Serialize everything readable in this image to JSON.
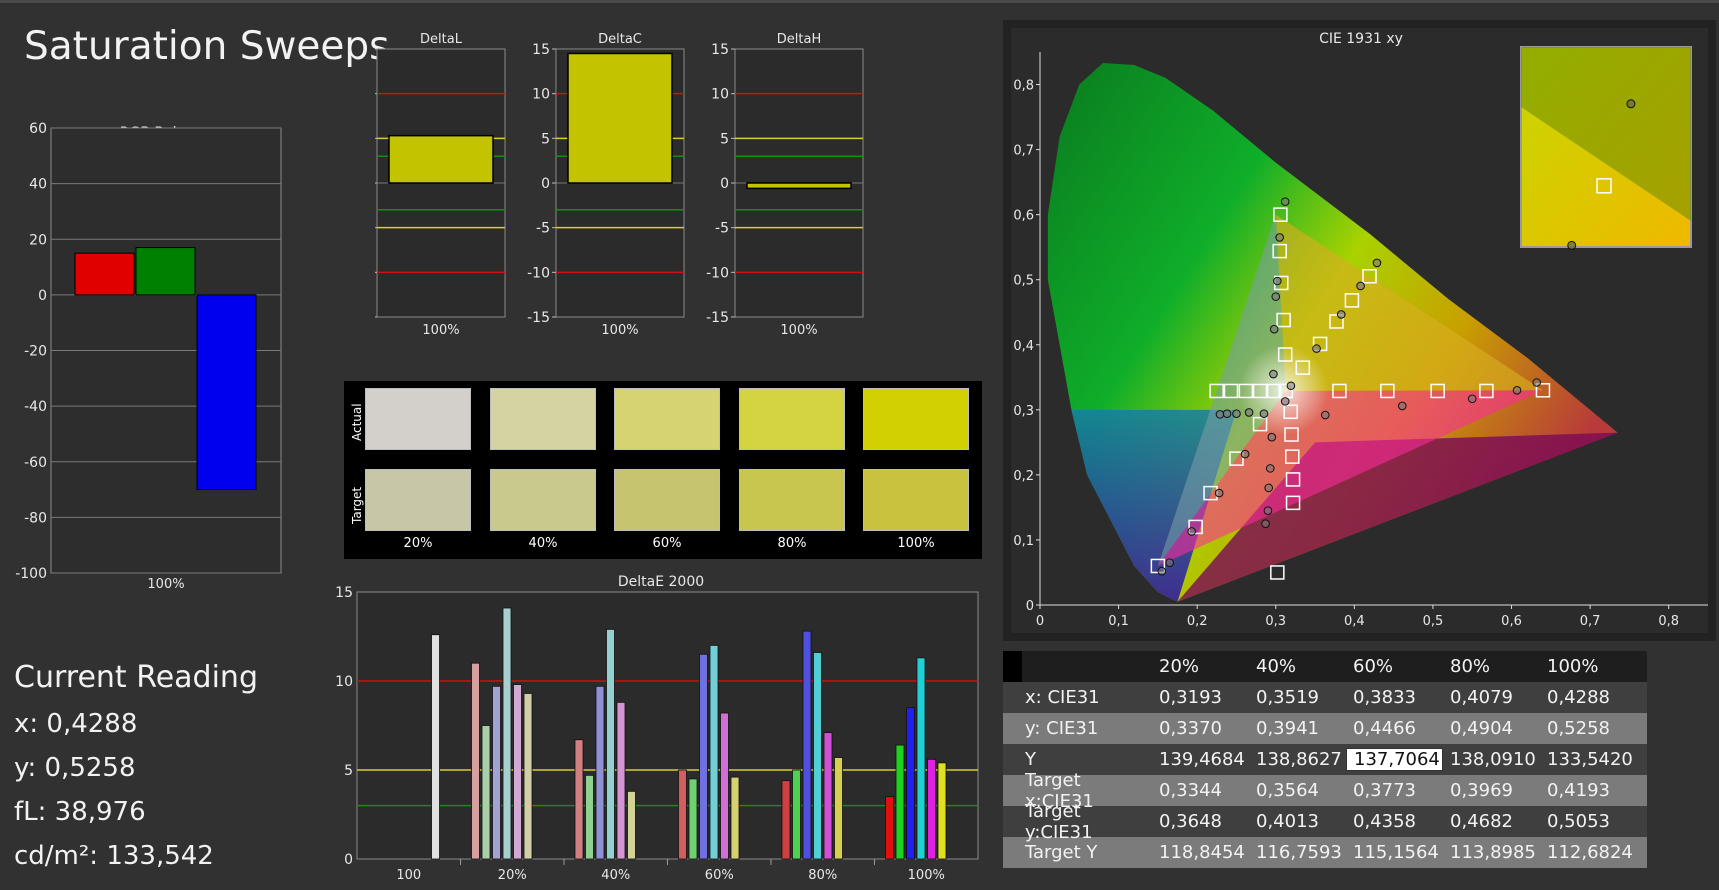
{
  "page_title": "Saturation Sweeps",
  "current_reading": {
    "heading": "Current Reading",
    "x": "x: 0,4288",
    "y": "y: 0,5258",
    "fl": "fL: 38,976",
    "cdm2": "cd/m²: 133,542"
  },
  "swatches": {
    "row_labels": [
      "Actual",
      "Target"
    ],
    "labels": [
      "20%",
      "40%",
      "60%",
      "80%",
      "100%"
    ],
    "actual_colors": [
      "#d3d0cb",
      "#d4d3a2",
      "#d5d470",
      "#d4d341",
      "#d3d002"
    ],
    "target_colors": [
      "#c7c6a6",
      "#c9c88d",
      "#c7c46f",
      "#c8c64f",
      "#c7c33d"
    ]
  },
  "table": {
    "headers": [
      "20%",
      "40%",
      "60%",
      "80%",
      "100%"
    ],
    "rows": [
      {
        "label": "x: CIE31",
        "values": [
          "0,3193",
          "0,3519",
          "0,3833",
          "0,4079",
          "0,4288"
        ]
      },
      {
        "label": "y: CIE31",
        "values": [
          "0,3370",
          "0,3941",
          "0,4466",
          "0,4904",
          "0,5258"
        ]
      },
      {
        "label": "Y",
        "values": [
          "139,4684",
          "138,8627",
          "137,7064",
          "138,0910",
          "133,5420"
        ]
      },
      {
        "label": "Target x:CIE31",
        "values": [
          "0,3344",
          "0,3564",
          "0,3773",
          "0,3969",
          "0,4193"
        ]
      },
      {
        "label": "Target y:CIE31",
        "values": [
          "0,3648",
          "0,4013",
          "0,4358",
          "0,4682",
          "0,5053"
        ]
      },
      {
        "label": "Target Y",
        "values": [
          "118,8454",
          "116,7593",
          "115,1564",
          "113,8985",
          "112,6824"
        ]
      }
    ]
  },
  "chart_data": [
    {
      "type": "bar",
      "title": "RGB Balance",
      "categories": [
        "100%"
      ],
      "series": [
        {
          "values": [
            15
          ],
          "color": "#e00000"
        },
        {
          "values": [
            17
          ],
          "color": "#008000"
        },
        {
          "values": [
            -70
          ],
          "color": "#0000ee"
        }
      ],
      "ylim": [
        -100,
        60
      ],
      "yticks": [
        60,
        40,
        20,
        0,
        -20,
        -40,
        -60,
        -80,
        -100
      ]
    },
    {
      "type": "bar",
      "title": "DeltaL",
      "categories": [
        "100%"
      ],
      "values": [
        5.3
      ],
      "ylim": [
        -15,
        15
      ],
      "yticks": [
        15,
        10,
        5,
        0,
        -5,
        -10,
        -15
      ],
      "reference_lines": [
        {
          "y": 10,
          "color": "#d01010"
        },
        {
          "y": 5,
          "color": "#d7d02a"
        },
        {
          "y": 3,
          "color": "#138f13"
        },
        {
          "y": -3,
          "color": "#138f13"
        },
        {
          "y": -5,
          "color": "#d7d02a"
        },
        {
          "y": -10,
          "color": "#d01010"
        }
      ]
    },
    {
      "type": "bar",
      "title": "DeltaC",
      "categories": [
        "100%"
      ],
      "values": [
        14.5
      ],
      "ylim": [
        -15,
        15
      ],
      "yticks": [
        15,
        10,
        5,
        0,
        -5,
        -10,
        -15
      ],
      "reference_lines": [
        {
          "y": 10,
          "color": "#d01010"
        },
        {
          "y": 5,
          "color": "#d7d02a"
        },
        {
          "y": 3,
          "color": "#138f13"
        },
        {
          "y": -3,
          "color": "#138f13"
        },
        {
          "y": -5,
          "color": "#d7d02a"
        },
        {
          "y": -10,
          "color": "#d01010"
        }
      ]
    },
    {
      "type": "bar",
      "title": "DeltaH",
      "categories": [
        "100%"
      ],
      "values": [
        -0.6
      ],
      "ylim": [
        -15,
        15
      ],
      "yticks": [
        15,
        10,
        5,
        0,
        -5,
        -10,
        -15
      ],
      "reference_lines": [
        {
          "y": 10,
          "color": "#d01010"
        },
        {
          "y": 5,
          "color": "#d7d02a"
        },
        {
          "y": 3,
          "color": "#138f13"
        },
        {
          "y": -3,
          "color": "#138f13"
        },
        {
          "y": -5,
          "color": "#d7d02a"
        },
        {
          "y": -10,
          "color": "#d01010"
        }
      ]
    },
    {
      "type": "bar",
      "title": "DeltaE 2000",
      "categories": [
        "100",
        "20%",
        "40%",
        "60%",
        "80%",
        "100%"
      ],
      "ylim": [
        0,
        15
      ],
      "yticks": [
        15,
        10,
        5,
        0
      ],
      "reference_lines": [
        {
          "y": 10,
          "color": "#d01010"
        },
        {
          "y": 5,
          "color": "#d7d02a"
        },
        {
          "y": 3,
          "color": "#138f13"
        }
      ],
      "groups": [
        {
          "bars": [
            {
              "value": 12.6,
              "color": "#e0e0e0"
            }
          ]
        },
        {
          "bars": [
            {
              "value": 11.0,
              "color": "#d89f9f"
            },
            {
              "value": 7.5,
              "color": "#a8cfa8"
            },
            {
              "value": 9.7,
              "color": "#a3a3d3"
            },
            {
              "value": 14.1,
              "color": "#a8cfd0"
            },
            {
              "value": 9.8,
              "color": "#d4a8d4"
            },
            {
              "value": 9.3,
              "color": "#d2cfa8"
            }
          ]
        },
        {
          "bars": [
            {
              "value": 6.7,
              "color": "#d08080"
            },
            {
              "value": 4.7,
              "color": "#90d090"
            },
            {
              "value": 9.7,
              "color": "#9090d5"
            },
            {
              "value": 12.9,
              "color": "#95cfcf"
            },
            {
              "value": 8.8,
              "color": "#d595d5"
            },
            {
              "value": 3.8,
              "color": "#d5d295"
            }
          ]
        },
        {
          "bars": [
            {
              "value": 5.0,
              "color": "#d06060"
            },
            {
              "value": 4.5,
              "color": "#70d070"
            },
            {
              "value": 11.5,
              "color": "#7070e0"
            },
            {
              "value": 12.0,
              "color": "#70d0d5"
            },
            {
              "value": 8.2,
              "color": "#d070d5"
            },
            {
              "value": 4.6,
              "color": "#d5d070"
            }
          ]
        },
        {
          "bars": [
            {
              "value": 4.4,
              "color": "#d04040"
            },
            {
              "value": 5.0,
              "color": "#50d050"
            },
            {
              "value": 12.8,
              "color": "#5050e0"
            },
            {
              "value": 11.6,
              "color": "#50d0d5"
            },
            {
              "value": 7.1,
              "color": "#d050d5"
            },
            {
              "value": 5.7,
              "color": "#d5d050"
            }
          ]
        },
        {
          "bars": [
            {
              "value": 3.5,
              "color": "#e01010"
            },
            {
              "value": 6.4,
              "color": "#20d020"
            },
            {
              "value": 8.5,
              "color": "#2020f0"
            },
            {
              "value": 11.3,
              "color": "#20d0d5"
            },
            {
              "value": 5.6,
              "color": "#e020e0"
            },
            {
              "value": 5.4,
              "color": "#e0e020"
            }
          ]
        }
      ]
    },
    {
      "type": "scatter",
      "title": "CIE 1931 xy",
      "xlim": [
        0,
        0.85
      ],
      "ylim": [
        0,
        0.85
      ],
      "xticks": [
        "0",
        "0,1",
        "0,2",
        "0,3",
        "0,4",
        "0,5",
        "0,6",
        "0,7",
        "0,8"
      ],
      "yticks": [
        "0",
        "0,1",
        "0,2",
        "0,3",
        "0,4",
        "0,5",
        "0,6",
        "0,7",
        "0,8"
      ],
      "gamut_triangle": [
        [
          0.64,
          0.33
        ],
        [
          0.3,
          0.6
        ],
        [
          0.15,
          0.06
        ]
      ],
      "target_points": [
        [
          0.3127,
          0.329
        ],
        [
          0.3344,
          0.3648
        ],
        [
          0.3564,
          0.4013
        ],
        [
          0.3773,
          0.4358
        ],
        [
          0.3969,
          0.4682
        ],
        [
          0.4193,
          0.5053
        ],
        [
          0.3059,
          0.6
        ],
        [
          0.305,
          0.544
        ],
        [
          0.307,
          0.495
        ],
        [
          0.31,
          0.438
        ],
        [
          0.312,
          0.385
        ],
        [
          0.381,
          0.329
        ],
        [
          0.442,
          0.329
        ],
        [
          0.506,
          0.329
        ],
        [
          0.568,
          0.329
        ],
        [
          0.64,
          0.33
        ],
        [
          0.2248,
          0.329
        ],
        [
          0.243,
          0.329
        ],
        [
          0.262,
          0.329
        ],
        [
          0.28,
          0.329
        ],
        [
          0.298,
          0.329
        ],
        [
          0.302,
          0.05
        ],
        [
          0.198,
          0.12
        ],
        [
          0.217,
          0.172
        ],
        [
          0.25,
          0.225
        ],
        [
          0.28,
          0.278
        ],
        [
          0.319,
          0.297
        ],
        [
          0.32,
          0.262
        ],
        [
          0.321,
          0.228
        ],
        [
          0.322,
          0.193
        ],
        [
          0.322,
          0.157
        ],
        [
          0.15,
          0.06
        ]
      ],
      "measured_points": [
        [
          0.3193,
          0.337
        ],
        [
          0.3519,
          0.3941
        ],
        [
          0.3833,
          0.4466
        ],
        [
          0.4079,
          0.4904
        ],
        [
          0.4288,
          0.5258
        ],
        [
          0.312,
          0.62
        ],
        [
          0.305,
          0.565
        ],
        [
          0.302,
          0.498
        ],
        [
          0.3,
          0.474
        ],
        [
          0.298,
          0.424
        ],
        [
          0.297,
          0.355
        ],
        [
          0.363,
          0.292
        ],
        [
          0.461,
          0.306
        ],
        [
          0.55,
          0.317
        ],
        [
          0.607,
          0.33
        ],
        [
          0.632,
          0.342
        ],
        [
          0.229,
          0.293
        ],
        [
          0.238,
          0.294
        ],
        [
          0.25,
          0.294
        ],
        [
          0.266,
          0.296
        ],
        [
          0.285,
          0.294
        ],
        [
          0.312,
          0.313
        ],
        [
          0.165,
          0.065
        ],
        [
          0.193,
          0.113
        ],
        [
          0.228,
          0.172
        ],
        [
          0.261,
          0.232
        ],
        [
          0.295,
          0.258
        ],
        [
          0.293,
          0.21
        ],
        [
          0.291,
          0.18
        ],
        [
          0.29,
          0.145
        ],
        [
          0.287,
          0.125
        ],
        [
          0.155,
          0.052
        ]
      ],
      "inset": {
        "xlim": [
          0.39,
          0.45
        ],
        "ylim": [
          0.49,
          0.54
        ],
        "target": [
          0.4193,
          0.5053
        ],
        "measured": [
          [
            0.4288,
            0.5258
          ],
          [
            0.4079,
            0.4904
          ]
        ]
      }
    }
  ]
}
